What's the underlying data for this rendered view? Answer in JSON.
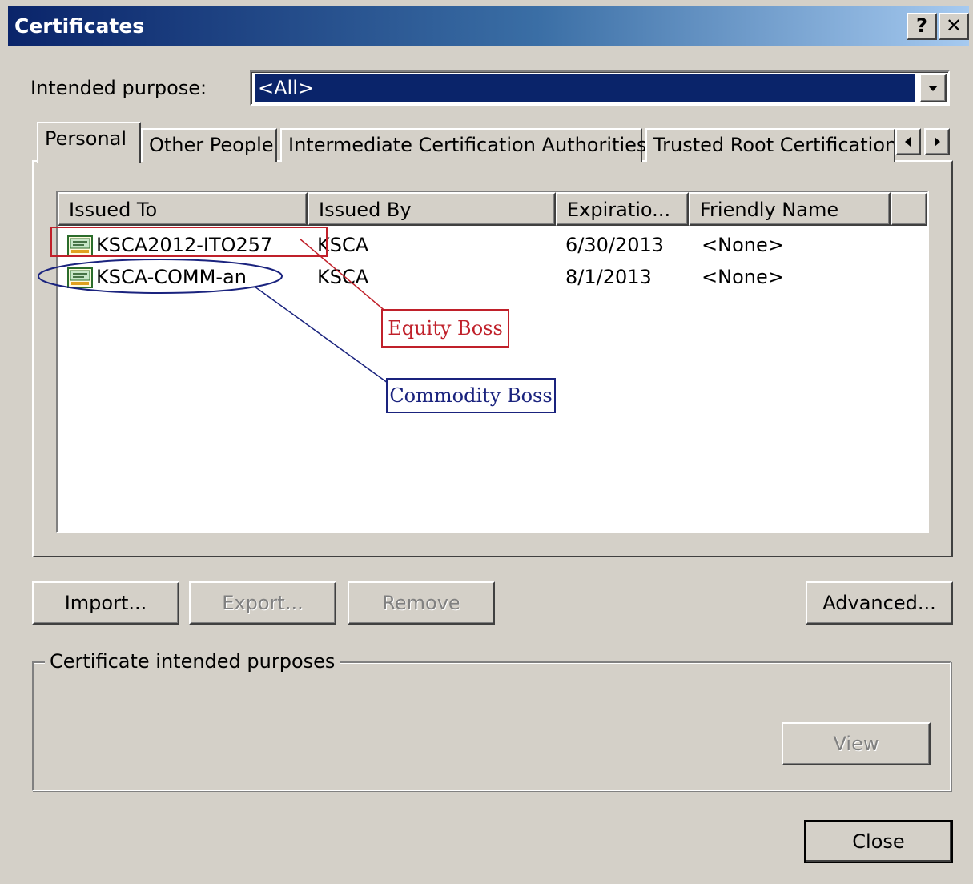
{
  "window": {
    "title": "Certificates",
    "help_label": "?",
    "close_label": "✕"
  },
  "purpose": {
    "label": "Intended purpose:",
    "value": "<All>"
  },
  "tabs": [
    {
      "label": "Personal",
      "active": true
    },
    {
      "label": "Other People",
      "active": false
    },
    {
      "label": "Intermediate Certification Authorities",
      "active": false
    },
    {
      "label": "Trusted Root Certification",
      "active": false
    }
  ],
  "list": {
    "columns": [
      "Issued To",
      "Issued By",
      "Expiratio...",
      "Friendly Name"
    ],
    "rows": [
      {
        "issued_to": "KSCA2012-ITO257",
        "issued_by": "KSCA",
        "expiration": "6/30/2013",
        "friendly_name": "<None>"
      },
      {
        "issued_to": "KSCA-COMM-an",
        "issued_by": "KSCA",
        "expiration": "8/1/2013",
        "friendly_name": "<None>"
      }
    ]
  },
  "annotations": {
    "equity": {
      "label": "Equity Boss",
      "color": "#c0202a"
    },
    "commodity": {
      "label": "Commodity Boss",
      "color": "#1a237e"
    }
  },
  "buttons": {
    "import": "Import...",
    "export": "Export...",
    "remove": "Remove",
    "advanced": "Advanced...",
    "view": "View",
    "close": "Close"
  },
  "purposes_group": {
    "label": "Certificate intended purposes"
  },
  "icons": {
    "scroll_left": "scroll-left-icon",
    "scroll_right": "scroll-right-icon",
    "dropdown": "chevron-down-icon",
    "certificate": "certificate-icon"
  }
}
